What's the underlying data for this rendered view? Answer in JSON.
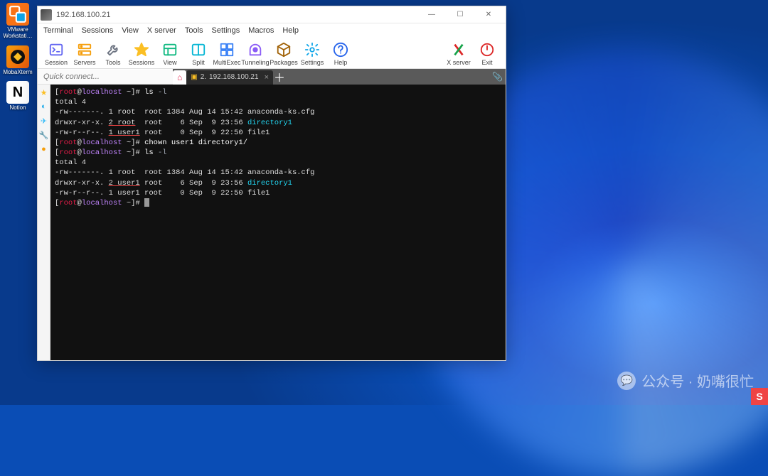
{
  "desktop": {
    "icons": [
      {
        "label": "VMware\nWorkstati…",
        "name": "vmware-icon"
      },
      {
        "label": "MobaXterm",
        "name": "mobaxterm-icon"
      },
      {
        "label": "Notion",
        "name": "notion-icon"
      }
    ]
  },
  "window": {
    "title": "192.168.100.21",
    "controls": {
      "min": "—",
      "max": "☐",
      "close": "✕"
    }
  },
  "menu": [
    "Terminal",
    "Sessions",
    "View",
    "X server",
    "Tools",
    "Settings",
    "Macros",
    "Help"
  ],
  "toolbar": {
    "left": [
      {
        "label": "Session",
        "name": "session-button",
        "glyph": "terminal",
        "color": "#6366f1"
      },
      {
        "label": "Servers",
        "name": "servers-button",
        "glyph": "servers",
        "color": "#f59e0b"
      },
      {
        "label": "Tools",
        "name": "tools-button",
        "glyph": "wrench",
        "color": "#6b7280"
      },
      {
        "label": "Sessions",
        "name": "sessions-button",
        "glyph": "star",
        "color": "#fbbf24"
      },
      {
        "label": "View",
        "name": "view-button",
        "glyph": "layout",
        "color": "#10b981"
      },
      {
        "label": "Split",
        "name": "split-button",
        "glyph": "split",
        "color": "#06b6d4"
      },
      {
        "label": "MultiExec",
        "name": "multiexec-button",
        "glyph": "multi",
        "color": "#3b82f6"
      },
      {
        "label": "Tunneling",
        "name": "tunneling-button",
        "glyph": "tunnel",
        "color": "#8b5cf6"
      },
      {
        "label": "Packages",
        "name": "packages-button",
        "glyph": "package",
        "color": "#a16207"
      },
      {
        "label": "Settings",
        "name": "settings-button",
        "glyph": "gear",
        "color": "#0ea5e9"
      },
      {
        "label": "Help",
        "name": "help-button",
        "glyph": "help",
        "color": "#2563eb"
      }
    ],
    "right": [
      {
        "label": "X server",
        "name": "xserver-button",
        "glyph": "xserver",
        "color": "#16a34a"
      },
      {
        "label": "Exit",
        "name": "exit-button",
        "glyph": "power",
        "color": "#dc2626"
      }
    ]
  },
  "quick_connect_placeholder": "Quick connect...",
  "tabs": {
    "home_icon": "⌂",
    "active": {
      "index": "2.",
      "label": "192.168.100.21"
    },
    "add": "＋"
  },
  "sidebar_icons": [
    {
      "glyph": "★",
      "color": "#fbbf24",
      "name": "favorites-tab"
    },
    {
      "glyph": "◐",
      "color": "#0ea5e9",
      "name": "sessions-tab"
    },
    {
      "glyph": "✈",
      "color": "#38bdf8",
      "name": "sftp-tab"
    },
    {
      "glyph": "🔧",
      "color": "#6b7280",
      "name": "tools-tab"
    },
    {
      "glyph": "●",
      "color": "#f59e0b",
      "name": "macros-tab"
    }
  ],
  "terminal": {
    "prompt": {
      "user": "root",
      "at": "@",
      "host": "localhost",
      "path": " ~",
      "open": "[",
      "close": "]# "
    },
    "lines": [
      {
        "t": "prompt",
        "cmd": "ls ",
        "flag": "-l"
      },
      {
        "t": "plain",
        "text": "total 4"
      },
      {
        "t": "ls",
        "perm": "-rw-------. 1 root  root 1384 Aug 14 15:42 ",
        "name": "anaconda-ks.cfg",
        "dir": false
      },
      {
        "t": "ls",
        "perm": "drwxr-xr-x. ",
        "ul": "2 root",
        "rest": "  root    6 Sep  9 23:56 ",
        "name": "directory1",
        "dir": true
      },
      {
        "t": "ls",
        "perm": "-rw-r--r--. ",
        "ul": "1 user1",
        "rest": " root    0 Sep  9 22:50 ",
        "name": "file1",
        "dir": false
      },
      {
        "t": "prompt",
        "cmd": "chown user1 directory1/"
      },
      {
        "t": "prompt",
        "cmd": "ls ",
        "flag": "-l"
      },
      {
        "t": "plain",
        "text": "total 4"
      },
      {
        "t": "ls",
        "perm": "-rw-------. 1 root  root 1384 Aug 14 15:42 ",
        "name": "anaconda-ks.cfg",
        "dir": false
      },
      {
        "t": "ls",
        "perm": "drwxr-xr-x. ",
        "ul": "2 user1",
        "rest": " root    6 Sep  9 23:56 ",
        "name": "directory1",
        "dir": true
      },
      {
        "t": "ls",
        "perm": "-rw-r--r--. 1 user1 root    0 Sep  9 22:50 ",
        "name": "file1",
        "dir": false
      },
      {
        "t": "prompt",
        "cmd": "",
        "cursor": true
      }
    ]
  },
  "watermark": "公众号 · 奶嘴很忙",
  "tray_letter": "S"
}
